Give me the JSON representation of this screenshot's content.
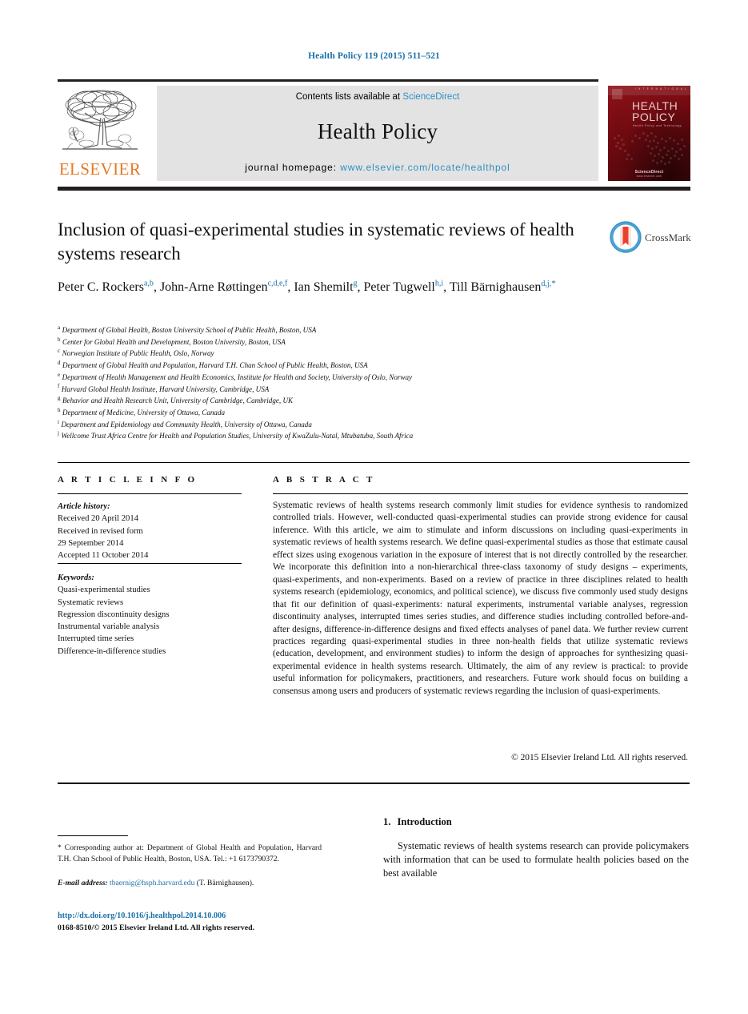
{
  "running_head": "Health Policy 119 (2015) 511–521",
  "masthead": {
    "contents_prefix": "Contents lists available at ",
    "contents_link": "ScienceDirect",
    "journal_title": "Health Policy",
    "homepage_prefix": "journal homepage: ",
    "homepage_url": "www.elsevier.com/locate/healthpol",
    "publisher_wordmark": "ELSEVIER",
    "cover": {
      "title_line1": "HEALTH",
      "title_line2": "POLICY",
      "subtitle": "Health Policy and Technology",
      "topbar": "I N T E R N A T I O N A L",
      "footer_brand": "ScienceDirect",
      "footer_note": "www.elsevier.com"
    }
  },
  "article": {
    "title": "Inclusion of quasi-experimental studies in systematic reviews of health systems research",
    "crossmark_label": "CrossMark",
    "authors": [
      {
        "name": "Peter C. Rockers",
        "marks": "a,b",
        "sep": ", "
      },
      {
        "name": "John-Arne Røttingen",
        "marks": "c,d,e,f",
        "sep": ", "
      },
      {
        "name": "Ian Shemilt",
        "marks": "g",
        "sep": ", "
      },
      {
        "name": "Peter Tugwell",
        "marks": "h,i",
        "sep": ", "
      },
      {
        "name": "Till Bärnighausen",
        "marks": "d,j,",
        "star": "*",
        "sep": ""
      }
    ],
    "affiliations": [
      {
        "mark": "a",
        "text": "Department of Global Health, Boston University School of Public Health, Boston, USA"
      },
      {
        "mark": "b",
        "text": "Center for Global Health and Development, Boston University, Boston, USA"
      },
      {
        "mark": "c",
        "text": "Norwegian Institute of Public Health, Oslo, Norway"
      },
      {
        "mark": "d",
        "text": "Department of Global Health and Population, Harvard T.H. Chan School of Public Health, Boston, USA"
      },
      {
        "mark": "e",
        "text": "Department of Health Management and Health Economics, Institute for Health and Society, University of Oslo, Norway"
      },
      {
        "mark": "f",
        "text": "Harvard Global Health Institute, Harvard University, Cambridge, USA"
      },
      {
        "mark": "g",
        "text": "Behavior and Health Research Unit, University of Cambridge, Cambridge, UK"
      },
      {
        "mark": "h",
        "text": "Department of Medicine, University of Ottawa, Canada"
      },
      {
        "mark": "i",
        "text": "Department and Epidemiology and Community Health, University of Ottawa, Canada"
      },
      {
        "mark": "j",
        "text": "Wellcome Trust Africa Centre for Health and Population Studies, University of KwaZulu-Natal, Mtubatuba, South Africa"
      }
    ]
  },
  "article_info": {
    "heading": "A R T I C L E    I N F O",
    "history_label": "Article history:",
    "history_lines": [
      "Received 20 April 2014",
      "Received in revised form",
      "29 September 2014",
      "Accepted 11 October 2014"
    ],
    "keywords_label": "Keywords:",
    "keywords": [
      "Quasi-experimental studies",
      "Systematic reviews",
      "Regression discontinuity designs",
      "Instrumental variable analysis",
      "Interrupted time series",
      "Difference-in-difference studies"
    ]
  },
  "abstract": {
    "heading": "A B S T R A C T",
    "text": "Systematic reviews of health systems research commonly limit studies for evidence synthesis to randomized controlled trials. However, well-conducted quasi-experimental studies can provide strong evidence for causal inference. With this article, we aim to stimulate and inform discussions on including quasi-experiments in systematic reviews of health systems research. We define quasi-experimental studies as those that estimate causal effect sizes using exogenous variation in the exposure of interest that is not directly controlled by the researcher. We incorporate this definition into a non-hierarchical three-class taxonomy of study designs – experiments, quasi-experiments, and non-experiments. Based on a review of practice in three disciplines related to health systems research (epidemiology, economics, and political science), we discuss five commonly used study designs that fit our definition of quasi-experiments: natural experiments, instrumental variable analyses, regression discontinuity analyses, interrupted times series studies, and difference studies including controlled before-and-after designs, difference-in-difference designs and fixed effects analyses of panel data. We further review current practices regarding quasi-experimental studies in three non-health fields that utilize systematic reviews (education, development, and environment studies) to inform the design of approaches for synthesizing quasi-experimental evidence in health systems research. Ultimately, the aim of any review is practical: to provide useful information for policymakers, practitioners, and researchers. Future work should focus on building a consensus among users and producers of systematic reviews regarding the inclusion of quasi-experiments.",
    "copyright": "© 2015 Elsevier Ireland Ltd. All rights reserved."
  },
  "footer": {
    "corresponding_star": "*",
    "corresponding_text": "Corresponding author at: Department of Global Health and Population, Harvard T.H. Chan School of Public Health, Boston, USA. Tel.: +1 6173790372.",
    "email_label": "E-mail address:",
    "email": "tbaernig@hsph.harvard.edu",
    "email_owner": "(T. Bärnighausen).",
    "doi": "http://dx.doi.org/10.1016/j.healthpol.2014.10.006",
    "issn": "0168-8510/© 2015 Elsevier Ireland Ltd. All rights reserved."
  },
  "introduction": {
    "number": "1.",
    "heading": "Introduction",
    "paragraph": "Systematic reviews of health systems research can provide policymakers with information that can be used to formulate health policies based on the best available"
  },
  "colors": {
    "link_blue": "#1b70a8",
    "sciencedirect_blue": "#2f8fc4",
    "elsevier_orange": "#e87722",
    "cover_red": "#7c0b12",
    "rule_black": "#231f20"
  }
}
